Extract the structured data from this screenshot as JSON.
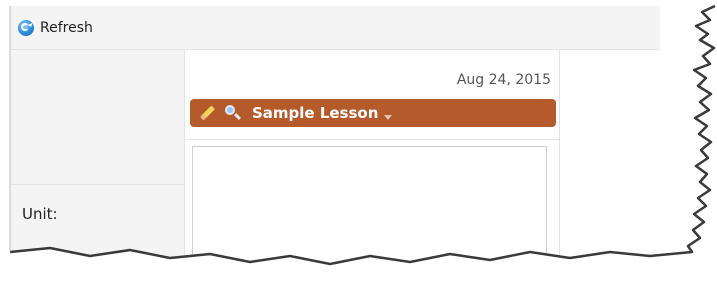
{
  "toolbar": {
    "refresh_label": "Refresh",
    "refresh_icon": "refresh-icon"
  },
  "lesson": {
    "date": "Aug 24, 2015",
    "title": "Sample Lesson",
    "bar_color": "#b45a2b",
    "icons": [
      "pencil-icon",
      "magnifier-icon",
      "chevron-down-icon"
    ]
  },
  "form": {
    "unit_label": "Unit:",
    "unit_value": ""
  }
}
